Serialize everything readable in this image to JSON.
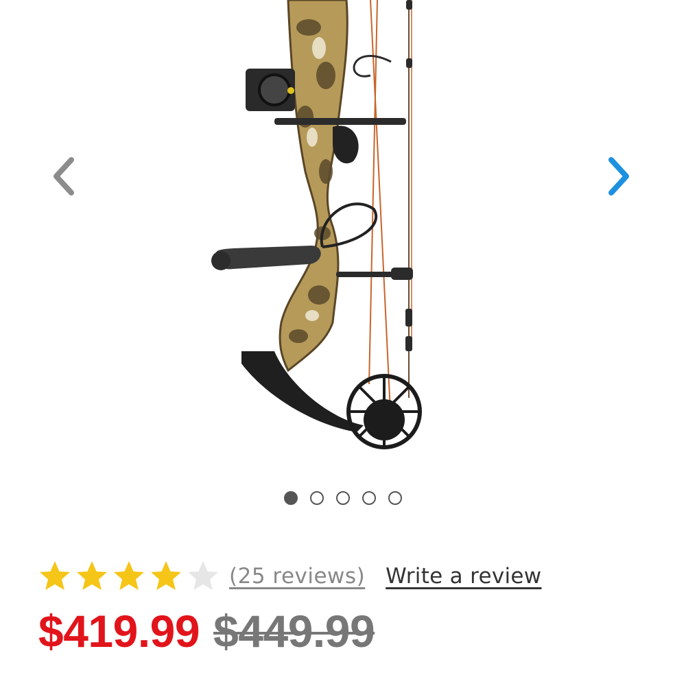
{
  "carousel": {
    "image_label": "compound bow product image",
    "slide_count": 5,
    "active_slide": 1,
    "prev_icon": "chevron-left-icon",
    "next_icon": "chevron-right-icon",
    "prev_color": "#8c8c8c",
    "next_color": "#1e90e0"
  },
  "rating": {
    "value": 4,
    "max": 5,
    "star_filled_color": "#f5c518",
    "star_empty_color": "#e6e6e6",
    "reviews_text": "(25 reviews)",
    "write_review_label": "Write a review"
  },
  "price": {
    "sale": "$419.99",
    "original": "$449.99",
    "sale_color": "#e2141b"
  }
}
